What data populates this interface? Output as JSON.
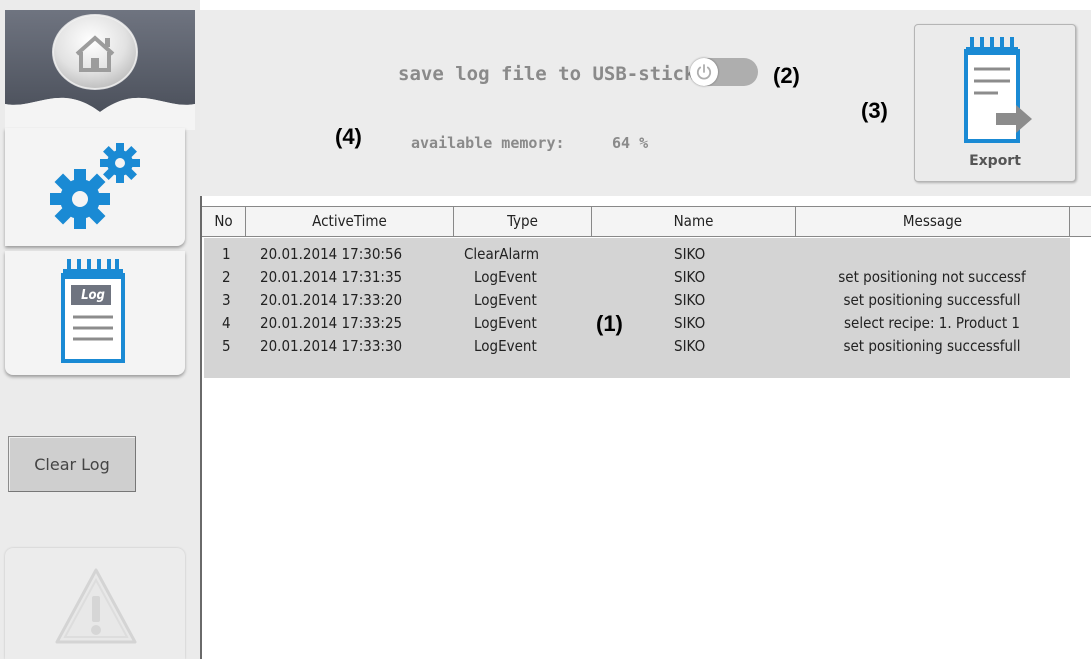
{
  "sidebar": {
    "home_icon": "home-icon",
    "settings_icon": "gears-icon",
    "log_icon": "log-notepad-icon",
    "log_icon_text": "Log",
    "warning_icon": "warning-icon",
    "clear_log_label": "Clear Log"
  },
  "header": {
    "usb_label": "save log file to USB-stick",
    "usb_toggle_state": "off",
    "memory_label": "available memory:",
    "memory_value": "64 %",
    "memory_percent": 64,
    "export_label": "Export",
    "export_icon": "export-document-icon"
  },
  "callouts": {
    "c1": "(1)",
    "c2": "(2)",
    "c3": "(3)",
    "c4": "(4)"
  },
  "table": {
    "columns": [
      "No",
      "ActiveTime",
      "Type",
      "Name",
      "Message"
    ],
    "rows": [
      {
        "no": "1",
        "time": "20.01.2014 17:30:56",
        "type": "ClearAlarm",
        "name": "SIKO",
        "message": ""
      },
      {
        "no": "2",
        "time": "20.01.2014 17:31:35",
        "type": "LogEvent",
        "name": "SIKO",
        "message": "set  positioning  not successf"
      },
      {
        "no": "3",
        "time": "20.01.2014 17:33:20",
        "type": "LogEvent",
        "name": "SIKO",
        "message": "set positioning successfull"
      },
      {
        "no": "4",
        "time": "20.01.2014 17:33:25",
        "type": "LogEvent",
        "name": "SIKO",
        "message": "select recipe: 1. Product 1"
      },
      {
        "no": "5",
        "time": "20.01.2014 17:33:30",
        "type": "LogEvent",
        "name": "SIKO",
        "message": "set positioning successfull"
      }
    ]
  },
  "colors": {
    "accent_blue": "#1a8ad4",
    "panel_gray": "#ececec",
    "row_gray": "#d4d4d4"
  }
}
